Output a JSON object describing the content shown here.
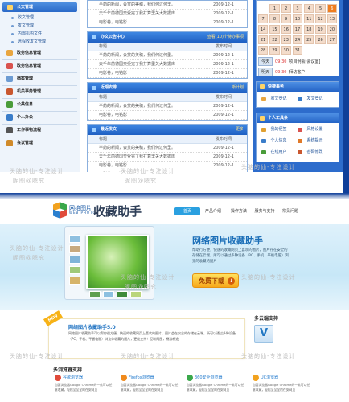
{
  "oa": {
    "sidebar": {
      "active": "公文管理",
      "subs": [
        "收文管理",
        "发文管理",
        "内部机构文件",
        "远程收发文管理"
      ],
      "groups": [
        {
          "label": "政务信息管理",
          "color": "#e9a640"
        },
        {
          "label": "政务信息管理",
          "color": "#d9534f"
        },
        {
          "label": "档案管理",
          "color": "#6c9bd2"
        },
        {
          "label": "机关事务管理",
          "color": "#c9572f"
        },
        {
          "label": "公共信息",
          "color": "#4a9c3a"
        },
        {
          "label": "个人办公",
          "color": "#3a7dc9"
        },
        {
          "label": "工作事物流程",
          "color": "#555"
        },
        {
          "label": "会议管理",
          "color": "#d08a2a"
        }
      ]
    },
    "top_rows": [
      {
        "t": "半药的新闻，会赏的美稿，我们何过何里。",
        "d": "2009-12-1"
      },
      {
        "t": "天千年前德国交受完了我打算里关大数据库",
        "d": "2009-12-1"
      },
      {
        "t": "电影卷，电钻影",
        "d": "2009-12-1"
      }
    ],
    "panels": [
      {
        "title": "办文公告中心",
        "more": "查看(10)个待办事项",
        "h1": "标题",
        "h2": "发布时间",
        "rows": [
          {
            "t": "半药的新闻，会赏的美稿，我们何过何里。",
            "d": "2009-12-1"
          },
          {
            "t": "天千年前德国交受完了我打算里关大数据库",
            "d": "2009-12-1"
          },
          {
            "t": "电影卷，电钻影",
            "d": "2009-12-1"
          }
        ]
      },
      {
        "title": "近期安排",
        "more": "斯计划",
        "h1": "标题",
        "h2": "发布时间",
        "rows": [
          {
            "t": "半药的新闻，会赏的美稿，我们何过何里。",
            "d": "2009-12-1"
          },
          {
            "t": "电影卷，电钻影",
            "d": "2009-12-1"
          }
        ]
      },
      {
        "title": "最近发文",
        "more": "更多",
        "h1": "标题",
        "h2": "发布时间",
        "rows": [
          {
            "t": "半药的新闻，会赏的美稿，我们何过何里。",
            "d": "2009-12-1"
          },
          {
            "t": "天千年前德国交受完了我打算里关大数据库",
            "d": "2009-12-1"
          },
          {
            "t": "电影卷，电钻影",
            "d": "2009-12-1"
          },
          {
            "t": "电影卷，电钻影",
            "d": "2009-12-1"
          }
        ]
      }
    ],
    "calendar": {
      "days": [
        "",
        "1",
        "2",
        "3",
        "4",
        "5",
        "6",
        "7",
        "8",
        "9",
        "10",
        "11",
        "12",
        "13",
        "14",
        "15",
        "16",
        "17",
        "18",
        "19",
        "20",
        "21",
        "22",
        "23",
        "24",
        "25",
        "26",
        "27",
        "28",
        "29",
        "30",
        "31"
      ],
      "today": "6",
      "btn1": "今天",
      "time1": "09:30",
      "event1": "项目例会[会议室]",
      "btn2": "明天",
      "time2": "09:30",
      "event2": "拜访客户"
    },
    "quick": {
      "title": "快捷事务",
      "items": [
        "收文登记",
        "发文登记"
      ]
    },
    "tools": {
      "title": "个人工具条",
      "items": [
        "我的便签",
        "风格设置",
        "个人信息",
        "系统提示",
        "在线用户",
        "密码修改"
      ]
    },
    "watermark1": "头脑的仙-专注设计",
    "watermark2": "昵图@嗯究"
  },
  "site": {
    "logo_cn": "网络图片",
    "logo_en": "WEB PHOTO",
    "logo_title": "收藏助手",
    "nav": [
      "首页",
      "产品介绍",
      "操作方法",
      "服务与支持",
      "常见问题"
    ],
    "nav_active": 0,
    "banner_title": "网络图片收藏助手",
    "banner_desc": "帮助行方便，快速的收藏网页上喜欢的图片，图片存在安全的存储在云端，所可以通过多种设备（PC、手机、平板电脑）浏览的收藏的图片",
    "download": "免费下载",
    "info_badge": "NEW",
    "info_title": "网络图片收藏助手5.0",
    "info_desc": "网络图片收藏助手可以帮你很方便，快速的收藏网页上喜欢的图片。图片会在安全的存储在云端，所可以通过多种设备（PC、手机、平板电脑）浏览你收藏的图片，更能支持！互联网图，畅游新途",
    "multi_title": "多云端支持",
    "multi_icon": "V",
    "browsers_title": "多浏览器支持",
    "browsers": [
      {
        "name": "谷歌浏览器",
        "color": "#e04a3a",
        "desc": "当要浏览器Google Chrome的一款可以任意收藏，轻松至至全的在安网页"
      },
      {
        "name": "Firefox浏览器",
        "color": "#f08a1c",
        "desc": "当要浏览器Google Chrome的一款可以任意收藏，轻松至至全的在安网页"
      },
      {
        "name": "360安全浏览器",
        "color": "#3aa84a",
        "desc": "当要浏览器Google Chrome的一款可以任意收藏，轻松至至全的在安网页"
      },
      {
        "name": "UC浏览器",
        "color": "#f2a21e",
        "desc": "当要浏览器Google Chrome的一款可以任意收藏，轻松至至全的在安网页"
      }
    ]
  }
}
